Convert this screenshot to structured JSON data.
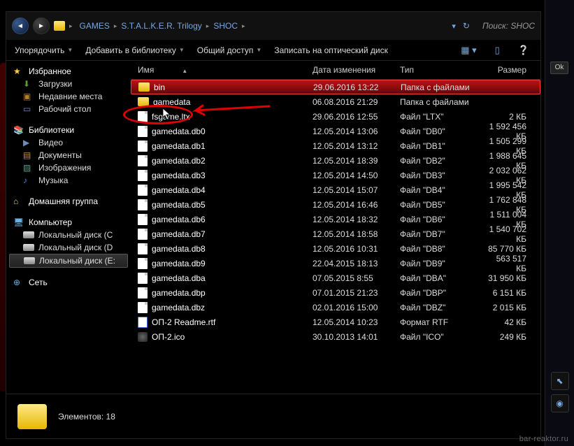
{
  "breadcrumb": {
    "c1": "GAMES",
    "c2": "S.T.A.L.K.E.R. Trilogy",
    "c3": "SHOC"
  },
  "search": {
    "label": "Поиск:",
    "term": "SHOC"
  },
  "toolbar": {
    "organize": "Упорядочить",
    "add_lib": "Добавить в библиотеку",
    "share": "Общий доступ",
    "burn": "Записать на оптический диск"
  },
  "columns": {
    "name": "Имя",
    "date": "Дата изменения",
    "type": "Тип",
    "size": "Размер"
  },
  "sidebar": {
    "fav": "Избранное",
    "fav_items": {
      "downloads": "Загрузки",
      "recent": "Недавние места",
      "desktop": "Рабочий стол"
    },
    "lib": "Библиотеки",
    "lib_items": {
      "video": "Видео",
      "docs": "Документы",
      "images": "Изображения",
      "music": "Музыка"
    },
    "home": "Домашняя группа",
    "comp": "Компьютер",
    "drives": {
      "c": "Локальный диск (C",
      "d": "Локальный диск (D",
      "e": "Локальный диск (E:"
    },
    "net": "Сеть"
  },
  "files": [
    {
      "name": "bin",
      "date": "29.06.2016 13:22",
      "type": "Папка с файлами",
      "size": "",
      "icon": "folder",
      "sel": true
    },
    {
      "name": "gamedata",
      "date": "06.08.2016 21:29",
      "type": "Папка с файлами",
      "size": "",
      "icon": "folder"
    },
    {
      "name": "fsgame.ltx",
      "date": "29.06.2016 12:55",
      "type": "Файл \"LTX\"",
      "size": "2 КБ",
      "icon": "file"
    },
    {
      "name": "gamedata.db0",
      "date": "12.05.2014 13:06",
      "type": "Файл \"DB0\"",
      "size": "1 592 456 КБ",
      "icon": "file"
    },
    {
      "name": "gamedata.db1",
      "date": "12.05.2014 13:12",
      "type": "Файл \"DB1\"",
      "size": "1 505 299 КБ",
      "icon": "file"
    },
    {
      "name": "gamedata.db2",
      "date": "12.05.2014 18:39",
      "type": "Файл \"DB2\"",
      "size": "1 988 645 КБ",
      "icon": "file"
    },
    {
      "name": "gamedata.db3",
      "date": "12.05.2014 14:50",
      "type": "Файл \"DB3\"",
      "size": "2 032 062 КБ",
      "icon": "file"
    },
    {
      "name": "gamedata.db4",
      "date": "12.05.2014 15:07",
      "type": "Файл \"DB4\"",
      "size": "1 995 542 КБ",
      "icon": "file"
    },
    {
      "name": "gamedata.db5",
      "date": "12.05.2014 16:46",
      "type": "Файл \"DB5\"",
      "size": "1 762 848 КБ",
      "icon": "file"
    },
    {
      "name": "gamedata.db6",
      "date": "12.05.2014 18:32",
      "type": "Файл \"DB6\"",
      "size": "1 511 004 КБ",
      "icon": "file"
    },
    {
      "name": "gamedata.db7",
      "date": "12.05.2014 18:58",
      "type": "Файл \"DB7\"",
      "size": "1 540 702 КБ",
      "icon": "file"
    },
    {
      "name": "gamedata.db8",
      "date": "12.05.2016 10:31",
      "type": "Файл \"DB8\"",
      "size": "85 770 КБ",
      "icon": "file"
    },
    {
      "name": "gamedata.db9",
      "date": "22.04.2015 18:13",
      "type": "Файл \"DB9\"",
      "size": "563 517 КБ",
      "icon": "file"
    },
    {
      "name": "gamedata.dba",
      "date": "07.05.2015 8:55",
      "type": "Файл \"DBA\"",
      "size": "31 950 КБ",
      "icon": "file"
    },
    {
      "name": "gamedata.dbp",
      "date": "07.01.2015 21:23",
      "type": "Файл \"DBP\"",
      "size": "6 151 КБ",
      "icon": "file"
    },
    {
      "name": "gamedata.dbz",
      "date": "02.01.2016 15:00",
      "type": "Файл \"DBZ\"",
      "size": "2 015 КБ",
      "icon": "file"
    },
    {
      "name": "ОП-2 Readme.rtf",
      "date": "12.05.2014 10:23",
      "type": "Формат RTF",
      "size": "42 КБ",
      "icon": "rtf"
    },
    {
      "name": "ОП-2.ico",
      "date": "30.10.2013 14:01",
      "type": "Файл \"ICO\"",
      "size": "249 КБ",
      "icon": "ico"
    }
  ],
  "status": {
    "label": "Элементов:",
    "count": "18"
  },
  "ok": "Ok",
  "watermark": "bar-reaktor.ru"
}
